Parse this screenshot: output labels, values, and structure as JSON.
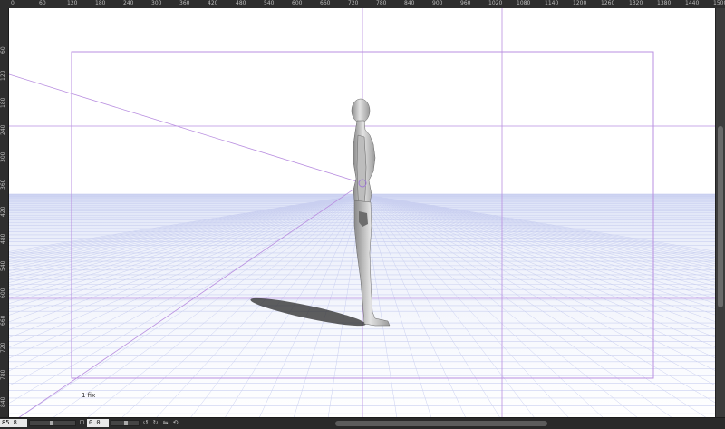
{
  "ruler": {
    "top_labels": [
      "0",
      "60",
      "120",
      "180",
      "240",
      "300",
      "360",
      "420",
      "480",
      "540",
      "600",
      "660",
      "720",
      "780",
      "840",
      "900",
      "960",
      "1020",
      "1080",
      "1140",
      "1200",
      "1260",
      "1320",
      "1380",
      "1440",
      "1500"
    ],
    "left_labels": [
      "60",
      "120",
      "180",
      "240",
      "300",
      "360",
      "420",
      "480",
      "540",
      "600",
      "660",
      "720",
      "780",
      "840"
    ]
  },
  "canvas": {
    "frame_label": "1 fix",
    "horizon_color": "#c9cff0",
    "guide_color": "#b98fe0",
    "figure_color": "#c8c8c8"
  },
  "statusbar": {
    "zoom_value": "85.8",
    "angle_value": "0.0",
    "icons": [
      "rotate-left-icon",
      "rotate-right-icon",
      "flip-icon",
      "reset-icon"
    ]
  }
}
